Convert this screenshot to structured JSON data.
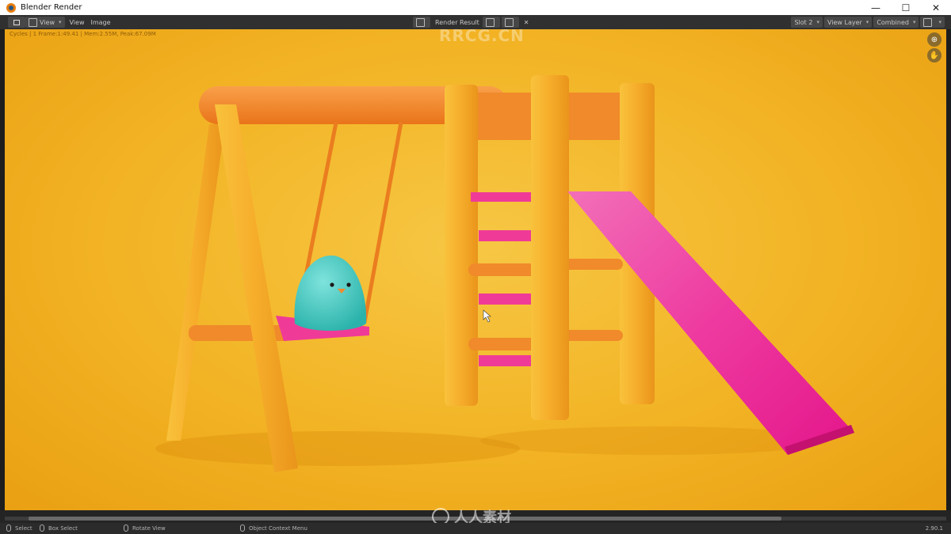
{
  "window": {
    "title": "Blender Render",
    "minimize": "—",
    "maximize": "☐",
    "close": "✕"
  },
  "header": {
    "menus": [
      "View",
      "View",
      "Image"
    ],
    "render_result": "Render Result",
    "slot": "Slot 2",
    "view_layer": "View Layer",
    "pass": "Combined"
  },
  "viewport": {
    "stats_text": "Cycles | 1 Frame:1:49.41 | Mem:2.55M, Peak:67.09M",
    "watermark_top": "RRCG.CN"
  },
  "statusbar": {
    "select": "Select",
    "box_select": "Box Select",
    "rotate_view": "Rotate View",
    "context_menu": "Object Context Menu",
    "version": "2.90.1",
    "watermark": "人人素材"
  },
  "colors": {
    "background_orange": "#f2b324",
    "wood": "#f5a623",
    "crossbar": "#f28c28",
    "slide_pink": "#ef2e9a",
    "chick": "#3fc8c0"
  }
}
